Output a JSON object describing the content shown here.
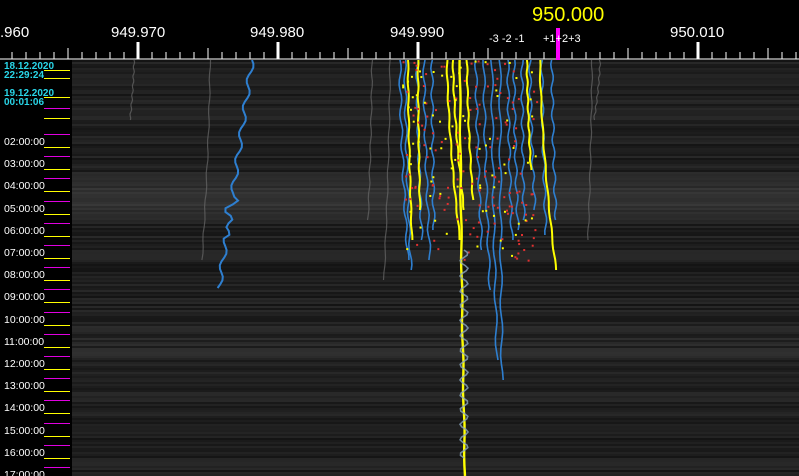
{
  "ruler": {
    "frequency_labels": [
      {
        "text": ".960",
        "freq": 949.96
      },
      {
        "text": "949.970",
        "freq": 949.97
      },
      {
        "text": "949.980",
        "freq": 949.98
      },
      {
        "text": "949.990",
        "freq": 949.99
      },
      {
        "text": "950.010",
        "freq": 950.01
      }
    ],
    "center_frequency": "950.000",
    "offset_left": "-3 -2 -1",
    "offset_right": "+1+2+3",
    "colors": {
      "tick": "#ffffff",
      "center_marker": "#ff00ff",
      "center_text": "#ffff00"
    }
  },
  "time_axis": {
    "session_start": {
      "date": "18.12.2020",
      "time": "22:29:24"
    },
    "session_now": {
      "date": "19.12.2020",
      "time": "00:01:06"
    },
    "hours": [
      "02:00:00",
      "03:00:00",
      "04:00:00",
      "05:00:00",
      "06:00:00",
      "07:00:00",
      "08:00:00",
      "09:00:00",
      "10:00:00",
      "11:00:00",
      "12:00:00",
      "13:00:00",
      "14:00:00",
      "15:00:00",
      "16:00:00",
      "17:00:00"
    ],
    "colors": {
      "date_text": "#29d6e8",
      "hour_tick": "#e000e0",
      "half_tick": "#ffff00"
    }
  },
  "waterfall": {
    "colors": {
      "background": "#151515",
      "trace_blue": "#2e7fd0",
      "trace_yellow": "#ffff00",
      "trace_red": "#e03030",
      "trace_faint": "#6a6a6a"
    }
  }
}
